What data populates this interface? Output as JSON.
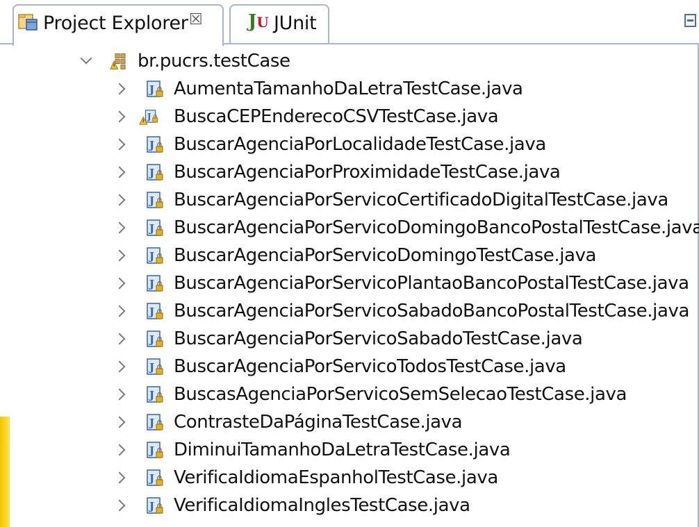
{
  "tabs": [
    {
      "label": "Project Explorer",
      "close_glyph": "☒",
      "icon": "project-explorer-icon",
      "active": true
    },
    {
      "label": "JUnit",
      "icon": "junit-icon",
      "icon_text_j": "J",
      "icon_text_u": "U",
      "active": false
    }
  ],
  "toolbar": {
    "minimize_icon": "minimize-icon"
  },
  "tree": {
    "package": {
      "label": "br.pucrs.testCase",
      "expanded": true,
      "icon": "package-warning-icon"
    },
    "files": [
      {
        "label": "AumentaTamanhoDaLetraTestCase.java",
        "warning": false
      },
      {
        "label": "BuscaCEPEnderecoCSVTestCase.java",
        "warning": true
      },
      {
        "label": "BuscarAgenciaPorLocalidadeTestCase.java",
        "warning": false
      },
      {
        "label": "BuscarAgenciaPorProximidadeTestCase.java",
        "warning": false
      },
      {
        "label": "BuscarAgenciaPorServicoCertificadoDigitalTestCase.java",
        "warning": false
      },
      {
        "label": "BuscarAgenciaPorServicoDomingoBancoPostalTestCase.java",
        "warning": false
      },
      {
        "label": "BuscarAgenciaPorServicoDomingoTestCase.java",
        "warning": false
      },
      {
        "label": "BuscarAgenciaPorServicoPlantaoBancoPostalTestCase.java",
        "warning": false
      },
      {
        "label": "BuscarAgenciaPorServicoSabadoBancoPostalTestCase.java",
        "warning": false
      },
      {
        "label": "BuscarAgenciaPorServicoSabadoTestCase.java",
        "warning": false
      },
      {
        "label": "BuscarAgenciaPorServicoTodosTestCase.java",
        "warning": false
      },
      {
        "label": "BuscasAgenciaPorServicoSemSelecaoTestCase.java",
        "warning": false
      },
      {
        "label": "ContrasteDaPáginaTestCase.java",
        "warning": false
      },
      {
        "label": "DiminuiTamanhoDaLetraTestCase.java",
        "warning": false
      },
      {
        "label": "VerificaIdiomaEspanholTestCase.java",
        "warning": false
      },
      {
        "label": "VerificaIdiomaInglesTestCase.java",
        "warning": false
      }
    ]
  },
  "colors": {
    "tab_border": "#a9b6c8",
    "java_icon_blue": "#2f67b2",
    "lock_yellow": "#e8b21c",
    "warning_yellow": "#f0c419"
  }
}
